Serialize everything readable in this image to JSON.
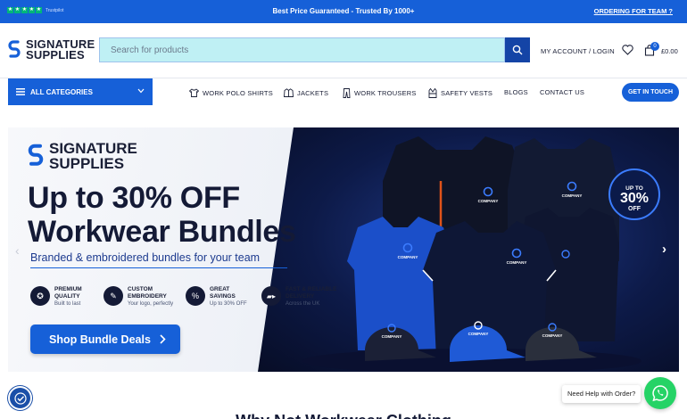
{
  "topbar": {
    "trustpilot_label": "Trustpilot",
    "promo": "Best Price Guaranteed - Trusted By 1000+",
    "order_link": "ORDERING FOR TEAM ?"
  },
  "header": {
    "logo_line1": "SIGNATURE",
    "logo_line2": "SUPPLIES",
    "search_placeholder": "Search for products",
    "account": "MY ACCOUNT / LOGIN",
    "cart_count": "0",
    "cart_total": "£0.00"
  },
  "nav": {
    "all_categories": "ALL CATEGORIES",
    "items": [
      {
        "label": "WORK POLO SHIRTS",
        "icon": "polo-shirt-icon"
      },
      {
        "label": "JACKETS",
        "icon": "jacket-icon"
      },
      {
        "label": "WORK TROUSERS",
        "icon": "trousers-icon"
      },
      {
        "label": "SAFETY VESTS",
        "icon": "vest-icon"
      },
      {
        "label": "BLOGS"
      },
      {
        "label": "CONTACT US"
      }
    ],
    "cta": "GET IN TOUCH"
  },
  "hero": {
    "logo_line1": "SIGNATURE",
    "logo_line2": "SUPPLIES",
    "headline_line1": "Up to 30% OFF",
    "headline_line2": "Workwear Bundles",
    "subheadline": "Branded & embroidered bundles for your team",
    "features": [
      {
        "title1": "PREMIUM",
        "title2": "QUALITY",
        "sub": "Built to last",
        "icon": "medal-icon"
      },
      {
        "title1": "CUSTOM",
        "title2": "EMBROIDERY",
        "sub": "Your logo, perfectly",
        "icon": "needle-icon"
      },
      {
        "title1": "GREAT",
        "title2": "SAVINGS",
        "sub": "Up to 30% OFF",
        "icon": "tag-icon"
      },
      {
        "title1": "FAST & RELIABLE",
        "title2": "DELIVERY",
        "sub": "Across the UK",
        "icon": "truck-icon"
      }
    ],
    "cta": "Shop Bundle Deals",
    "badge_upto": "UP TO",
    "badge_pct": "30%",
    "badge_off": "OFF",
    "garment_label": "COMPANY"
  },
  "footer": {
    "help_text": "Need Help with Order?",
    "section_heading": "Why Not Workwear Clothing"
  },
  "colors": {
    "brand_blue": "#1660d8",
    "navy": "#141a36",
    "search_bg": "#bff0f4",
    "whatsapp": "#25d366"
  }
}
